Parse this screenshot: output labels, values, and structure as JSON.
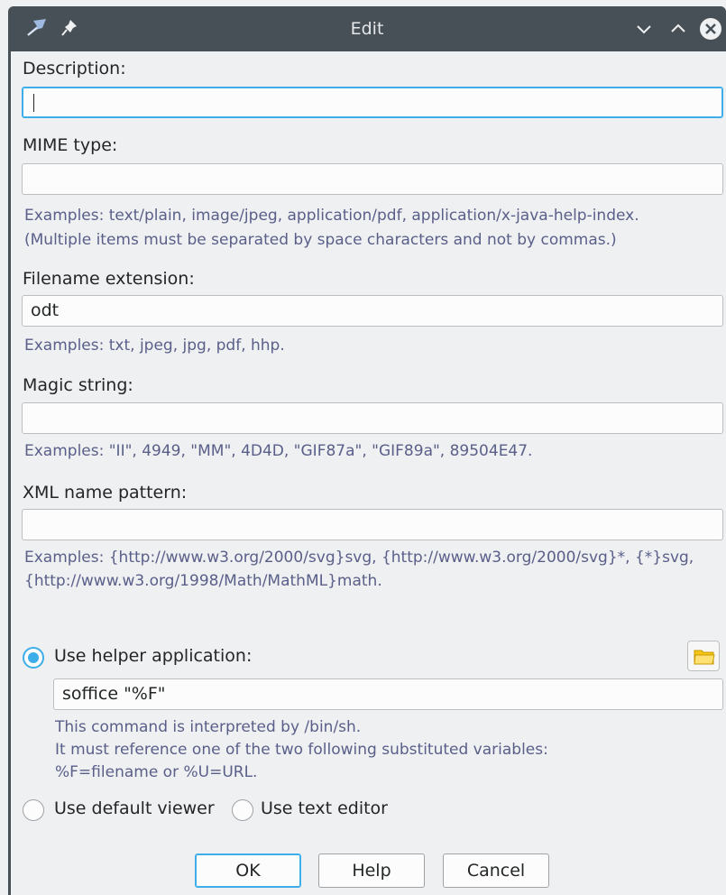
{
  "window": {
    "title": "Edit",
    "app_icon": "kde-app-icon",
    "pin_icon": "pin-icon",
    "controls": [
      "minimize-icon",
      "maximize-icon",
      "close-icon"
    ]
  },
  "form": {
    "description": {
      "label": "Description:",
      "value": ""
    },
    "mime_type": {
      "label": "MIME type:",
      "value": "",
      "hint_line1": "Examples: text/plain, image/jpeg, application/pdf, application/x-java-help-index.",
      "hint_line2": "(Multiple items must be separated by space characters and not by commas.)"
    },
    "extension": {
      "label": "Filename extension:",
      "value": "odt",
      "hint": "Examples: txt, jpeg, jpg, pdf, hhp."
    },
    "magic": {
      "label": "Magic string:",
      "value": "",
      "hint": "Examples: \"II\", 4949, \"MM\", 4D4D, \"GIF87a\", \"GIF89a\", 89504E47."
    },
    "xml_pattern": {
      "label": "XML name pattern:",
      "value": "",
      "hint_line1": "Examples: {http://www.w3.org/2000/svg}svg, {http://www.w3.org/2000/svg}*, {*}svg,",
      "hint_line2": "{http://www.w3.org/1998/Math/MathML}math."
    }
  },
  "viewer": {
    "helper_label": "Use helper application:",
    "helper_selected": true,
    "command_value": "soffice \"%F\"",
    "command_hint_line1": "This command is interpreted by /bin/sh.",
    "command_hint_line2": "It must reference one of the two following substituted variables:",
    "command_hint_line3": "%F=filename or %U=URL.",
    "default_viewer_label": "Use default viewer",
    "text_editor_label": "Use text editor",
    "browse_icon": "folder-icon"
  },
  "buttons": {
    "ok": "OK",
    "help": "Help",
    "cancel": "Cancel"
  },
  "colors": {
    "accent": "#3daee9",
    "titlebar": "#475057",
    "hint_text": "#5a5f8a"
  }
}
